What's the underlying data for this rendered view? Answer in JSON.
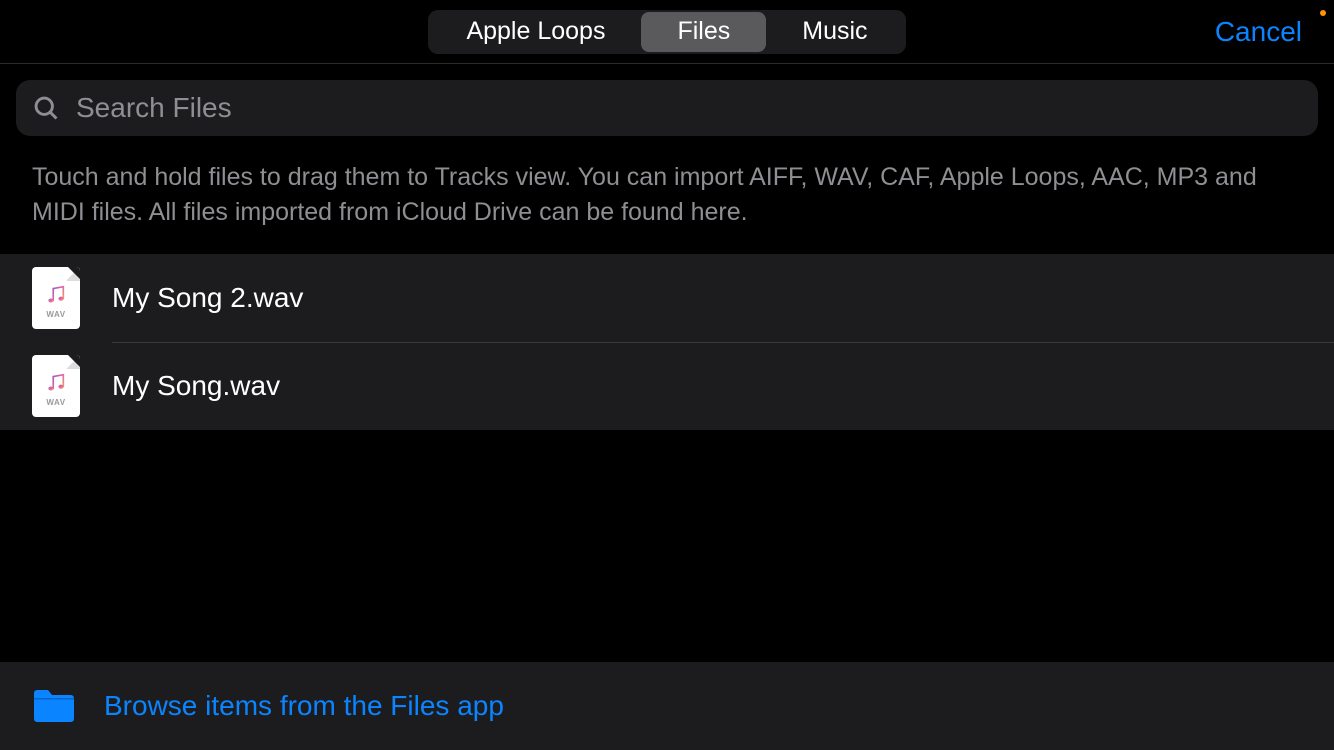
{
  "header": {
    "tabs": [
      {
        "label": "Apple Loops",
        "active": false
      },
      {
        "label": "Files",
        "active": true
      },
      {
        "label": "Music",
        "active": false
      }
    ],
    "cancel_label": "Cancel"
  },
  "search": {
    "placeholder": "Search Files",
    "value": ""
  },
  "hint": "Touch and hold files to drag them to Tracks view. You can import AIFF, WAV, CAF, Apple Loops, AAC, MP3 and MIDI files. All files imported from iCloud Drive can be found here.",
  "files": [
    {
      "name": "My Song 2.wav",
      "ext": "WAV"
    },
    {
      "name": "My Song.wav",
      "ext": "WAV"
    }
  ],
  "bottom": {
    "browse_label": "Browse items from the Files app"
  }
}
